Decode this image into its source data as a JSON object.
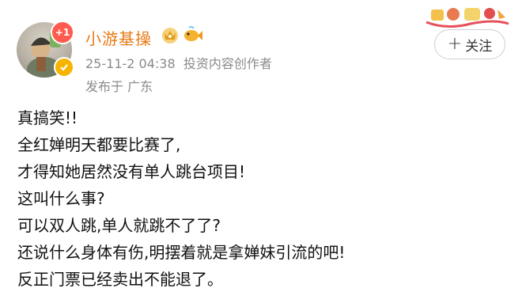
{
  "post": {
    "author": {
      "name": "小游基操",
      "plus_badge": "+1"
    },
    "timestamp": "25-11-2 04:38",
    "author_title": "投资内容创作者",
    "location": "发布于 广东",
    "follow_label": "关注",
    "follow_icon": "+",
    "lines": [
      "真搞笑!!",
      "全红婵明天都要比赛了,",
      "才得知她居然没有单人跳台项目!",
      "这叫什么事?",
      "可以双人跳,单人就跳不了了?",
      "还说什么身体有伤,明摆着就是拿婵妹引流的吧!",
      "反正门票已经卖出不能退了。"
    ]
  },
  "colors": {
    "username": "#e77a14",
    "meta": "#8a8a8a",
    "badge": "#ff5a4e",
    "verified": "#f5b400"
  },
  "icons": [
    "avatar-image",
    "verified-icon",
    "crown-badge-icon",
    "fish-badge-icon",
    "festival-decoration-icon",
    "plus-icon"
  ]
}
